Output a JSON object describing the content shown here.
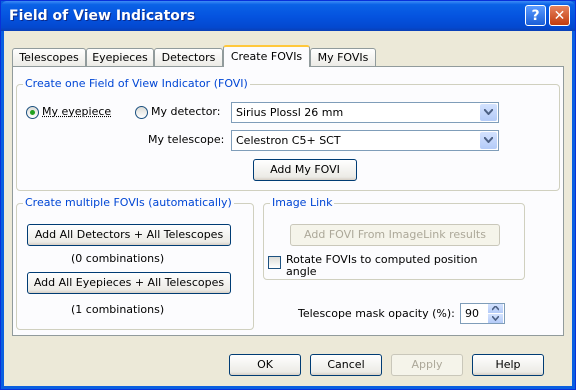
{
  "window": {
    "title": "Field of View Indicators",
    "help_glyph": "?",
    "close_glyph": "✕"
  },
  "tabs": [
    {
      "label": "Telescopes",
      "active": false
    },
    {
      "label": "Eyepieces",
      "active": false
    },
    {
      "label": "Detectors",
      "active": false
    },
    {
      "label": "Create FOVIs",
      "active": true
    },
    {
      "label": "My FOVIs",
      "active": false
    }
  ],
  "create_one": {
    "group_label": "Create one Field of View Indicator (FOVI)",
    "radio_eyepiece": {
      "label": "My eyepiece",
      "selected": true
    },
    "radio_detector": {
      "label": "My detector:",
      "selected": false
    },
    "detector_select": {
      "value": "Sirius Plossl 26 mm"
    },
    "telescope_label": "My telescope:",
    "telescope_select": {
      "value": "Celestron C5+ SCT"
    },
    "add_button": "Add My FOVI"
  },
  "create_multiple": {
    "group_label": "Create multiple FOVIs (automatically)",
    "add_detectors_button": "Add All Detectors + All Telescopes",
    "detectors_combinations": "(0 combinations)",
    "add_eyepieces_button": "Add All Eyepieces + All Telescopes",
    "eyepieces_combinations": "(1 combinations)"
  },
  "image_link": {
    "group_label": "Image Link",
    "add_button": "Add FOVI From ImageLink results",
    "rotate_label_line1": "Rotate FOVIs to computed position",
    "rotate_label_line2": "angle",
    "rotate_checked": false
  },
  "mask": {
    "label": "Telescope mask opacity (%):",
    "value": "90"
  },
  "footer": {
    "ok": "OK",
    "cancel": "Cancel",
    "apply": "Apply",
    "help": "Help"
  },
  "colors": {
    "titlebar": "#0554e0",
    "dialog_bg": "#ece9d8",
    "group_label": "#0046d5",
    "radio_dot": "#21a121"
  }
}
